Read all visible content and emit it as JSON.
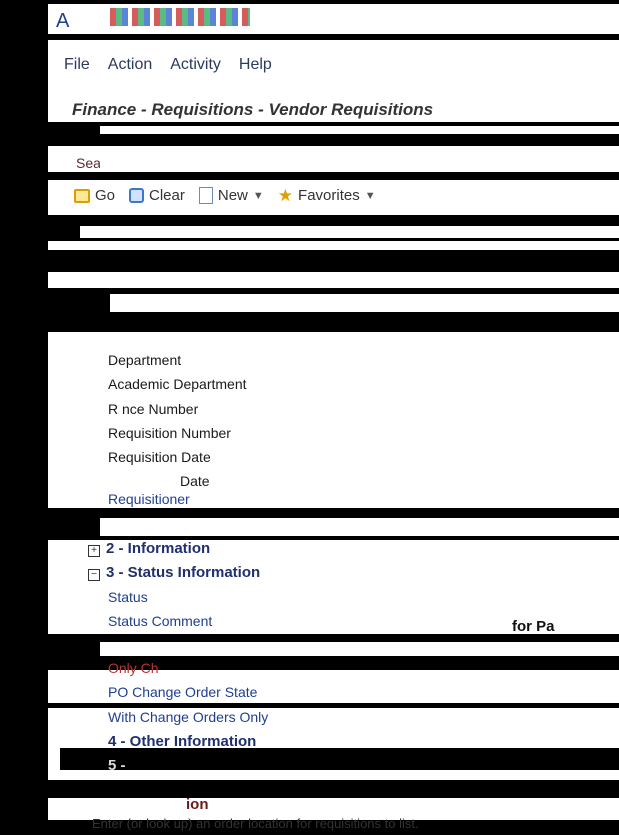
{
  "app_title": "A",
  "menu": [
    "File",
    "Action",
    "Activity",
    "Help"
  ],
  "breadcrumb": "Finance - Requisitions - Vendor Requisitions",
  "search": {
    "label": "Sea",
    "value": ""
  },
  "toolbar": {
    "go": "Go",
    "clear": "Clear",
    "new": "New",
    "favorites": "Favorites"
  },
  "fields": [
    {
      "label": "Department"
    },
    {
      "label": "Academic Department"
    },
    {
      "label": "R      nce Number"
    },
    {
      "label": "Requisition Number"
    },
    {
      "label": "Requisition Date"
    },
    {
      "label": "Date"
    },
    {
      "label": "Requisitioner"
    }
  ],
  "sections": {
    "s2": {
      "label": "2 -          Information",
      "state": "+"
    },
    "s3": {
      "label": "3 - Status Information",
      "state": "−"
    },
    "s4": {
      "label": "4 - Other Information"
    },
    "s5": {
      "label": "5 -"
    }
  },
  "status_fields": [
    "Status",
    "Status Comment"
  ],
  "side_text": "for Pa",
  "change_fields": [
    "Only Ch",
    "PO Change Order State",
    "With Change Orders Only"
  ],
  "footer_fragment": "ion",
  "hint": "Enter (or look up) an order location for requisitions to list.",
  "colors": {
    "accent": "#1f3f8f",
    "background": "#000000",
    "panel": "#ffffff"
  }
}
